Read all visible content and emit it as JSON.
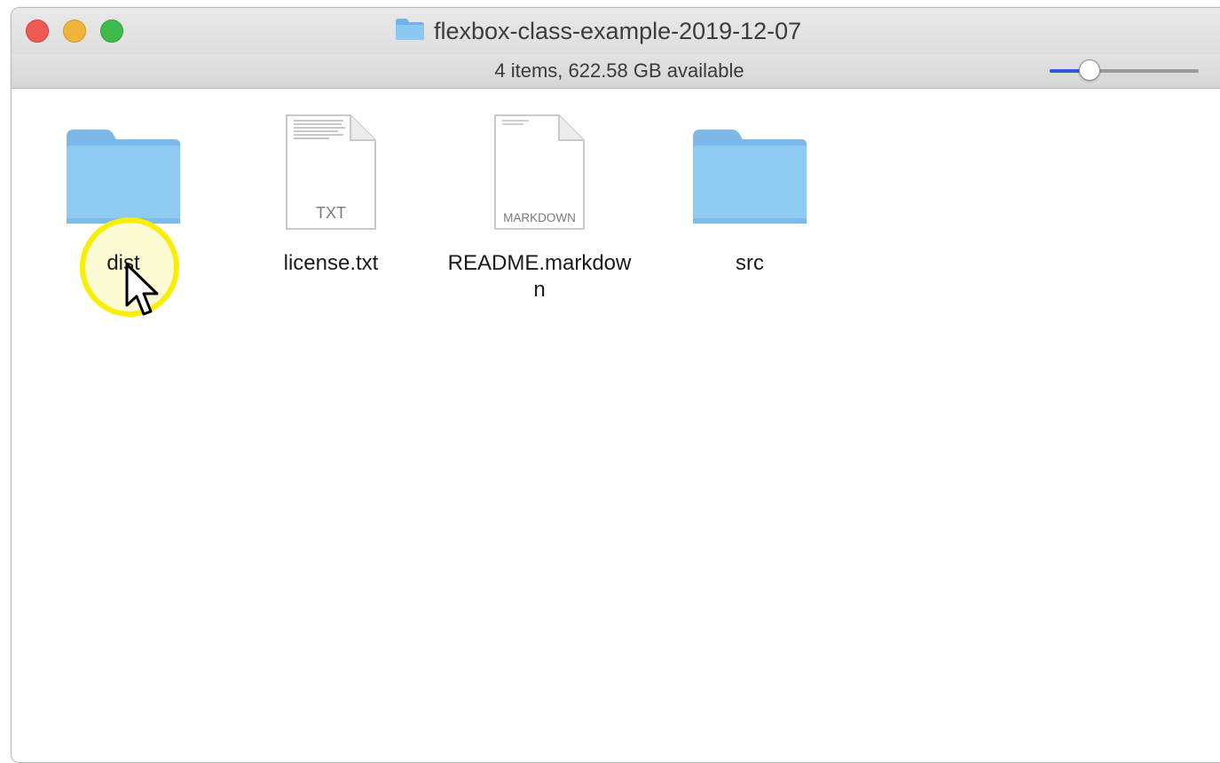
{
  "window": {
    "title": "flexbox-class-example-2019-12-07",
    "status": "4 items, 622.58 GB available",
    "zoom_level": 0.27
  },
  "colors": {
    "close": "#ee5a52",
    "minimize": "#f0b43a",
    "maximize": "#3fbb4d",
    "folder": "#8cc4ee",
    "highlight": "#f8ef00",
    "slider_fill": "#2a5bd7"
  },
  "items": [
    {
      "name": "dist",
      "icon": "folder-icon"
    },
    {
      "name": "license.txt",
      "icon": "txt-file-icon",
      "badge": "TXT"
    },
    {
      "name": "README.markdown",
      "icon": "markdown-file-icon",
      "badge": "MARKDOWN"
    },
    {
      "name": "src",
      "icon": "folder-icon"
    }
  ]
}
